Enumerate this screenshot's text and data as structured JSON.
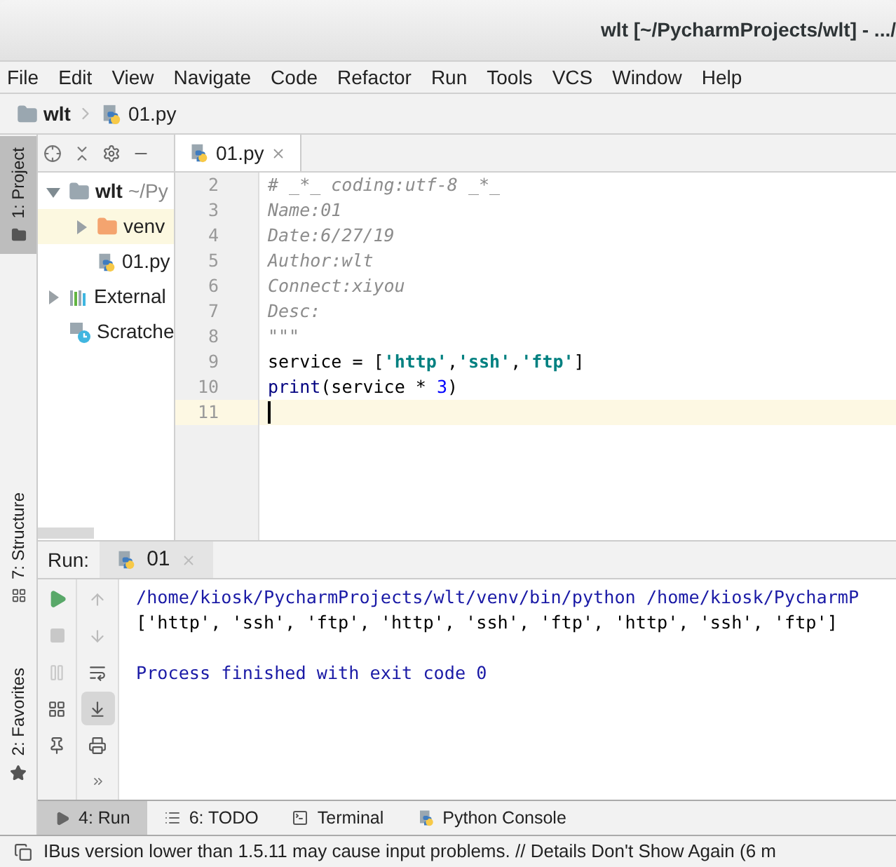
{
  "window": {
    "title": "wlt [~/PycharmProjects/wlt] - .../"
  },
  "menu": [
    "File",
    "Edit",
    "View",
    "Navigate",
    "Code",
    "Refactor",
    "Run",
    "Tools",
    "VCS",
    "Window",
    "Help"
  ],
  "breadcrumb": [
    {
      "label": "wlt",
      "kind": "folder"
    },
    {
      "label": "01.py",
      "kind": "python-file"
    }
  ],
  "side_tabs": [
    {
      "label": "1: Project",
      "kind": "project",
      "selected": true
    },
    {
      "label": "7: Structure",
      "kind": "structure",
      "selected": false
    },
    {
      "label": "2: Favorites",
      "kind": "favorites",
      "selected": false
    }
  ],
  "project_tree": [
    {
      "label": "wlt",
      "path": "~/Py",
      "kind": "folder",
      "expanded": true,
      "selected": false,
      "children": [
        {
          "label": "venv",
          "kind": "venv-folder",
          "expanded": false,
          "selected": true
        },
        {
          "label": "01.py",
          "kind": "python-file",
          "selected": false
        }
      ]
    },
    {
      "label": "External",
      "kind": "library",
      "expanded": false,
      "selected": false
    },
    {
      "label": "Scratche",
      "kind": "scratches",
      "selected": false
    }
  ],
  "editor_tabs": [
    {
      "label": "01.py",
      "selected": true
    }
  ],
  "code_lines": [
    {
      "number": "2",
      "current": false,
      "tokens": [
        {
          "text": "# _*_ coding:utf-8 _*_",
          "kind": "comment"
        }
      ]
    },
    {
      "number": "3",
      "current": false,
      "tokens": [
        {
          "text": "Name:01",
          "kind": "comment"
        }
      ]
    },
    {
      "number": "4",
      "current": false,
      "tokens": [
        {
          "text": "Date:6/27/19",
          "kind": "comment"
        }
      ]
    },
    {
      "number": "5",
      "current": false,
      "tokens": [
        {
          "text": "Author:wlt",
          "kind": "comment"
        }
      ]
    },
    {
      "number": "6",
      "current": false,
      "tokens": [
        {
          "text": "Connect:xiyou",
          "kind": "comment"
        }
      ]
    },
    {
      "number": "7",
      "current": false,
      "tokens": [
        {
          "text": "Desc:",
          "kind": "comment"
        }
      ]
    },
    {
      "number": "8",
      "current": false,
      "tokens": [
        {
          "text": "\"\"\"",
          "kind": "comment"
        }
      ]
    },
    {
      "number": "9",
      "current": false,
      "tokens": [
        {
          "text": "service = [",
          "kind": "plain"
        },
        {
          "text": "'http'",
          "kind": "string"
        },
        {
          "text": ",",
          "kind": "plain"
        },
        {
          "text": "'ssh'",
          "kind": "string"
        },
        {
          "text": ",",
          "kind": "plain"
        },
        {
          "text": "'ftp'",
          "kind": "string"
        },
        {
          "text": "]",
          "kind": "plain"
        }
      ]
    },
    {
      "number": "10",
      "current": false,
      "tokens": [
        {
          "text": "print",
          "kind": "builtin"
        },
        {
          "text": "(service * ",
          "kind": "plain"
        },
        {
          "text": "3",
          "kind": "number"
        },
        {
          "text": ")",
          "kind": "plain"
        }
      ]
    },
    {
      "number": "11",
      "current": true
    }
  ],
  "run_panel": {
    "label": "Run:",
    "tabs": [
      {
        "label": "01",
        "selected": true
      }
    ],
    "output": [
      {
        "text": "/home/kiosk/PycharmProjects/wlt/venv/bin/python /home/kiosk/PycharmP",
        "kind": "system"
      },
      {
        "text": "['http', 'ssh', 'ftp', 'http', 'ssh', 'ftp', 'http', 'ssh', 'ftp']",
        "kind": "stdout"
      },
      {
        "kind": "blank"
      },
      {
        "text": "Process finished with exit code 0",
        "kind": "system"
      }
    ]
  },
  "bottom_tabs": [
    {
      "label": "4: Run",
      "kind": "run",
      "selected": true
    },
    {
      "label": "6: TODO",
      "kind": "todo",
      "selected": false
    },
    {
      "label": "Terminal",
      "kind": "terminal",
      "selected": false
    },
    {
      "label": "Python Console",
      "kind": "console",
      "selected": false
    }
  ],
  "status_bar": {
    "message": "IBus version lower than 1.5.11 may cause input problems. // Details Don't Show Again (6 m"
  }
}
